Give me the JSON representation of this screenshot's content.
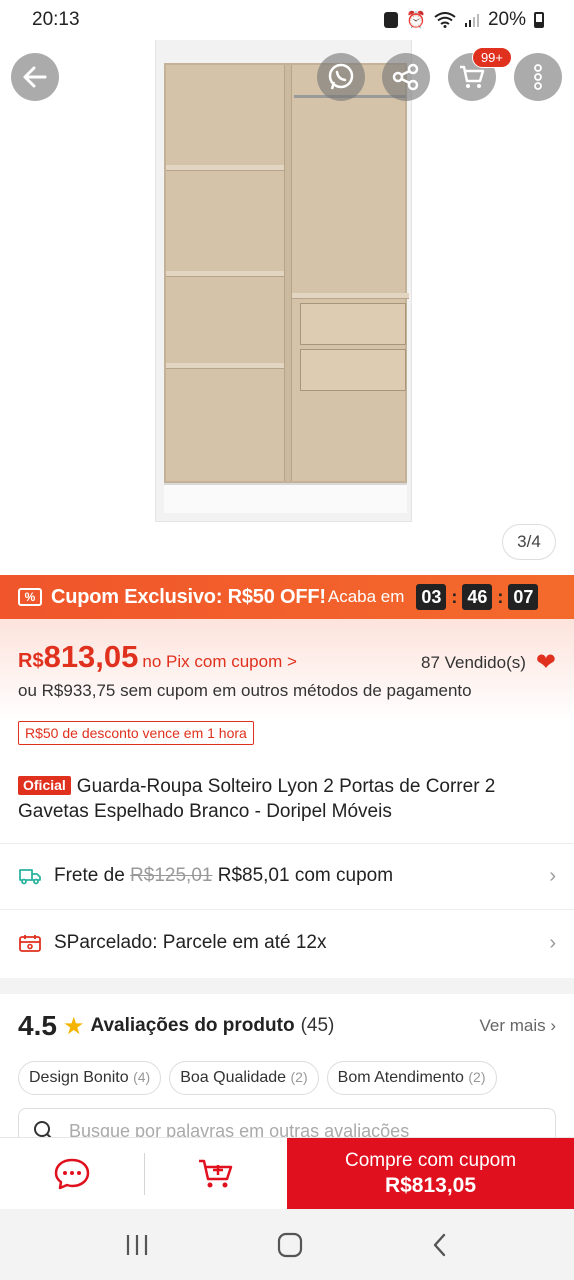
{
  "status_bar": {
    "time": "20:13",
    "battery": "20%"
  },
  "gallery": {
    "counter": "3/4",
    "cart_badge": "99+"
  },
  "coupon": {
    "title": "Cupom Exclusivo: R$50 OFF!",
    "ends_label": "Acaba em",
    "timer": {
      "hours": "03",
      "minutes": "46",
      "seconds": "07"
    }
  },
  "price": {
    "currency": "R$",
    "value": "813,05",
    "pix_label": "no Pix com cupom >",
    "sold": "87 Vendido(s)",
    "alt_text": "ou R$933,75 sem cupom em outros métodos de pagamento",
    "discount_tag": "R$50 de desconto vence em 1 hora"
  },
  "product": {
    "badge": "Oficial",
    "title": "Guarda-Roupa Solteiro Lyon 2 Portas de Correr 2 Gavetas Espelhado Branco - Doripel Móveis"
  },
  "shipping": {
    "prefix": "Frete de",
    "old_price": "R$125,01",
    "new_text": "R$85,01 com cupom"
  },
  "installments": {
    "text": "SParcelado: Parcele em até 12x"
  },
  "reviews": {
    "rating": "4.5",
    "title": "Avaliações do produto",
    "count": "(45)",
    "see_more": "Ver mais",
    "chips": [
      {
        "label": "Design Bonito",
        "n": "(4)"
      },
      {
        "label": "Boa Qualidade",
        "n": "(2)"
      },
      {
        "label": "Bom Atendimento",
        "n": "(2)"
      }
    ],
    "search_placeholder": "Busque por palavras em outras avaliações"
  },
  "action_bar": {
    "buy_label": "Compre com cupom",
    "buy_price": "R$813,05"
  },
  "colors": {
    "accent": "#e0301e",
    "banner": "#f0552b",
    "buy_button": "#e0101e"
  }
}
